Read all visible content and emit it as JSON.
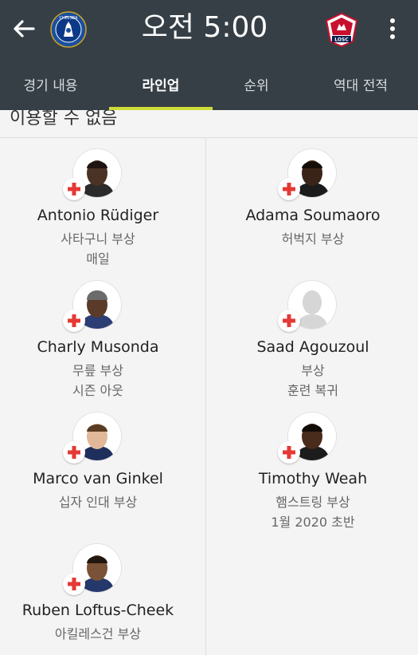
{
  "header": {
    "time": "오전 5:00",
    "home_crest_icon": "chelsea-crest-icon",
    "away_crest_icon": "losc-crest-icon",
    "home_crest_text": "CHELSEA",
    "away_crest_text": "LOSC"
  },
  "tabs": [
    {
      "label": "경기 내용"
    },
    {
      "label": "라인업"
    },
    {
      "label": "순위"
    },
    {
      "label": "역대 전적"
    }
  ],
  "section": {
    "label": "이용할 수 없음"
  },
  "colors": {
    "header_bg": "#363f45",
    "tab_indicator": "#cddc39",
    "injury_cross": "#e53935"
  },
  "home_players": [
    {
      "name": "Antonio Rüdiger",
      "injury": "사타구니 부상",
      "return": "매일"
    },
    {
      "name": "Charly Musonda",
      "injury": "무릎 부상",
      "return": "시즌 아웃"
    },
    {
      "name": "Marco van Ginkel",
      "injury": "십자 인대 부상",
      "return": ""
    },
    {
      "name": "Ruben Loftus-Cheek",
      "injury": "아킬레스건 부상",
      "return": ""
    }
  ],
  "away_players": [
    {
      "name": "Adama Soumaoro",
      "injury": "허벅지 부상",
      "return": ""
    },
    {
      "name": "Saad Agouzoul",
      "injury": "부상",
      "return": "훈련 복귀"
    },
    {
      "name": "Timothy Weah",
      "injury": "햄스트링 부상",
      "return": "1월 2020 초반"
    }
  ]
}
